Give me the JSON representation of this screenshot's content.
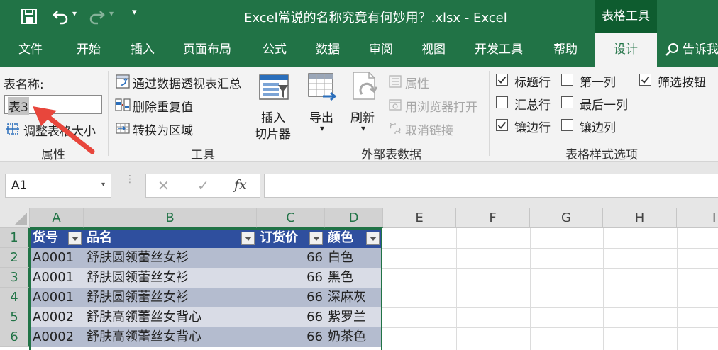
{
  "titlebar": {
    "document_title": "Excel常说的名称究竟有何妙用？.xlsx  -  Excel",
    "context_tools": "表格工具",
    "undo_dropdown": "▾",
    "redo_dropdown": "▾",
    "qat_dropdown": "▾"
  },
  "tabs": [
    {
      "label": "文件"
    },
    {
      "label": "开始"
    },
    {
      "label": "插入"
    },
    {
      "label": "页面布局"
    },
    {
      "label": "公式"
    },
    {
      "label": "数据"
    },
    {
      "label": "审阅"
    },
    {
      "label": "视图"
    },
    {
      "label": "开发工具"
    },
    {
      "label": "帮助"
    },
    {
      "label": "设计"
    }
  ],
  "tell_me": "告诉我",
  "ribbon": {
    "properties": {
      "table_name_label": "表名称:",
      "table_name_value": "表3",
      "resize_label": "调整表格大小",
      "group_label": "属性"
    },
    "tools": {
      "pivot_label": "通过数据透视表汇总",
      "remove_dup_label": "删除重复值",
      "convert_label": "转换为区域",
      "slicer_label_1": "插入",
      "slicer_label_2": "切片器",
      "group_label": "工具"
    },
    "external": {
      "export_label": "导出",
      "refresh_label": "刷新",
      "properties_label": "属性",
      "browser_label": "用浏览器打开",
      "unlink_label": "取消链接",
      "group_label": "外部表数据",
      "dropdown": "▾"
    },
    "style_options": {
      "header_row": {
        "label": "标题行",
        "checked": true
      },
      "first_column": {
        "label": "第一列",
        "checked": false
      },
      "filter_button": {
        "label": "筛选按钮",
        "checked": true
      },
      "total_row": {
        "label": "汇总行",
        "checked": false
      },
      "last_column": {
        "label": "最后一列",
        "checked": false
      },
      "banded_rows": {
        "label": "镶边行",
        "checked": true
      },
      "banded_columns": {
        "label": "镶边列",
        "checked": false
      },
      "group_label": "表格样式选项"
    }
  },
  "formula_bar": {
    "name_box": "A1",
    "name_dropdown": "▾",
    "cancel": "✕",
    "enter": "✓",
    "fx": "fx",
    "formula": ""
  },
  "grid": {
    "columns": [
      "A",
      "B",
      "C",
      "D",
      "E",
      "F",
      "G",
      "H",
      "I"
    ],
    "rows": [
      "1",
      "2",
      "3",
      "4",
      "5",
      "6"
    ],
    "table": {
      "headers": [
        "货号",
        "品名",
        "订货价",
        "颜色"
      ],
      "data": [
        [
          "A0001",
          "舒肤圆领蕾丝女衫",
          "66",
          "白色"
        ],
        [
          "A0001",
          "舒肤圆领蕾丝女衫",
          "66",
          "黑色"
        ],
        [
          "A0001",
          "舒肤圆领蕾丝女衫",
          "66",
          "深麻灰"
        ],
        [
          "A0002",
          "舒肤高领蕾丝女背心",
          "66",
          "紫罗兰"
        ],
        [
          "A0002",
          "舒肤高领蕾丝女背心",
          "66",
          "奶茶色"
        ]
      ]
    }
  },
  "colors": {
    "excel_green": "#217346",
    "table_header": "#2f4f9e",
    "table_band": "#b4bccf",
    "table_row": "#d9dce6",
    "arrow": "#e8463c"
  }
}
